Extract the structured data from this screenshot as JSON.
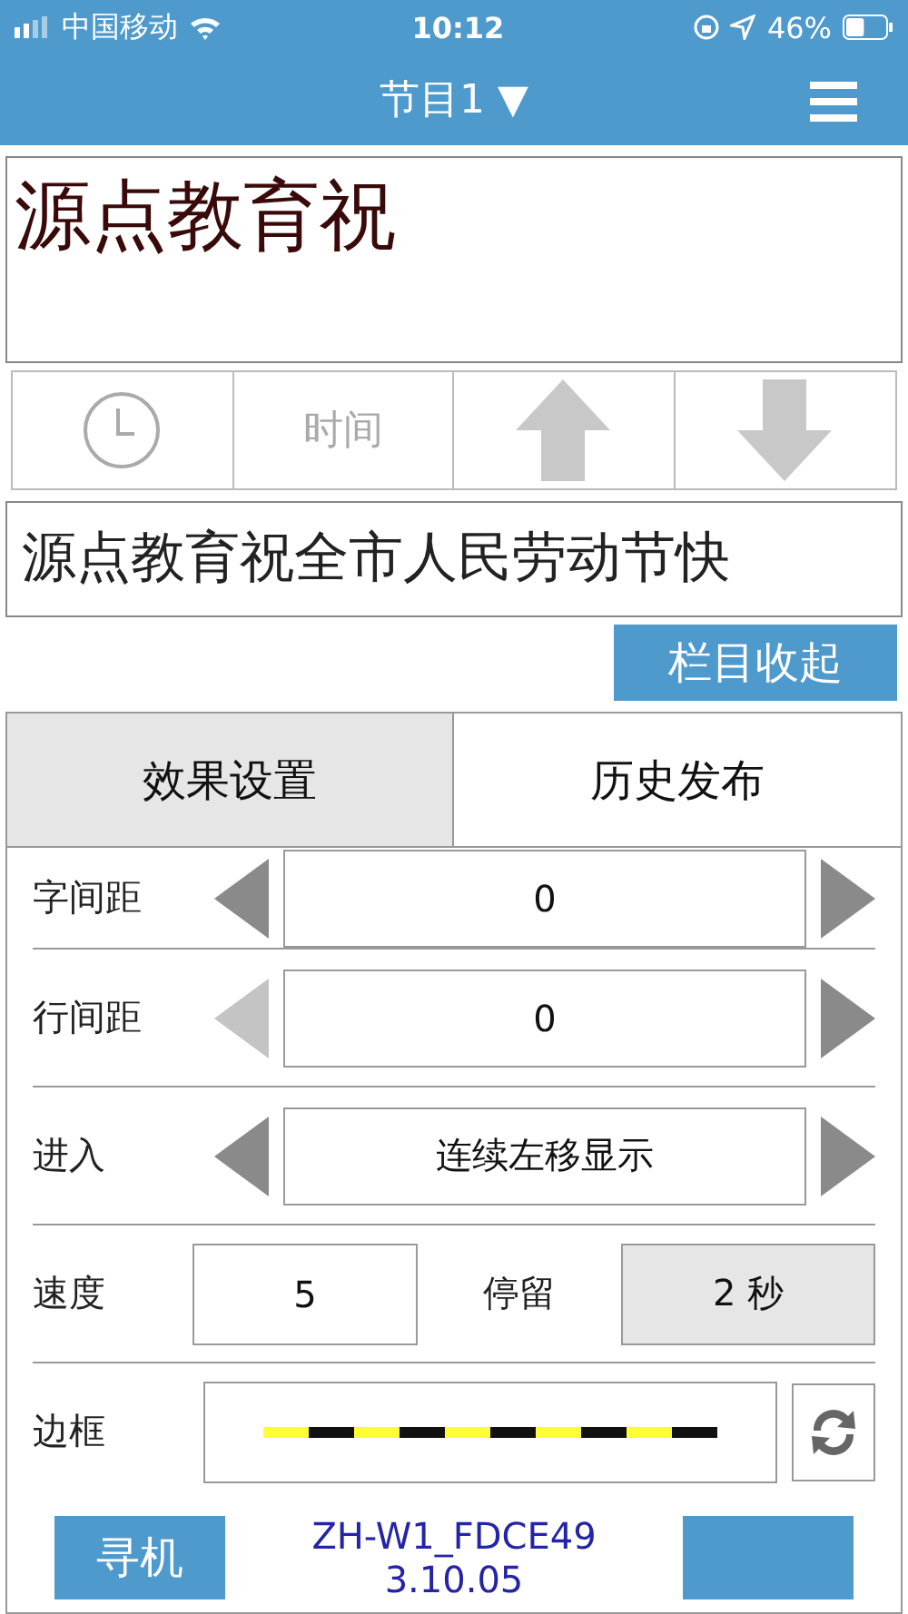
{
  "status_bar": {
    "carrier": "中国移动",
    "time": "10:12",
    "battery": "46%"
  },
  "nav": {
    "title": "节目1",
    "dropdown": "▼"
  },
  "preview": {
    "text": "源点教育祝"
  },
  "toolbar": [
    {
      "kind": "clock"
    },
    {
      "kind": "text",
      "label": "时间"
    },
    {
      "kind": "up"
    },
    {
      "kind": "down"
    }
  ],
  "message": {
    "text": "源点教育祝全市人民劳动节快"
  },
  "collapse_button": "栏目收起",
  "tabs": [
    {
      "label": "效果设置",
      "selected": true
    },
    {
      "label": "历史发布",
      "selected": false
    }
  ],
  "settings": [
    {
      "kind": "stepper",
      "label": "字间距",
      "value": "0",
      "left_disabled": false
    },
    {
      "kind": "stepper",
      "label": "行间距",
      "value": "0",
      "left_disabled": true
    },
    {
      "kind": "stepper",
      "label": "进入",
      "value": "连续左移显示",
      "left_disabled": false
    },
    {
      "kind": "pair",
      "label": "速度",
      "value": "5",
      "label_2": "停留",
      "value_2": "2 秒"
    },
    {
      "kind": "border",
      "label": "边框",
      "segments": [
        {
          "color": "#ffff33"
        },
        {
          "color": "#111111"
        },
        {
          "color": "#ffff33"
        },
        {
          "color": "#111111"
        },
        {
          "color": "#ffff33"
        },
        {
          "color": "#111111"
        },
        {
          "color": "#ffff33"
        },
        {
          "color": "#111111"
        },
        {
          "color": "#ffff33"
        },
        {
          "color": "#111111"
        }
      ]
    }
  ],
  "footer": {
    "search_button": "寻机",
    "device": "ZH-W1_FDCE49",
    "version": "3.10.05"
  }
}
